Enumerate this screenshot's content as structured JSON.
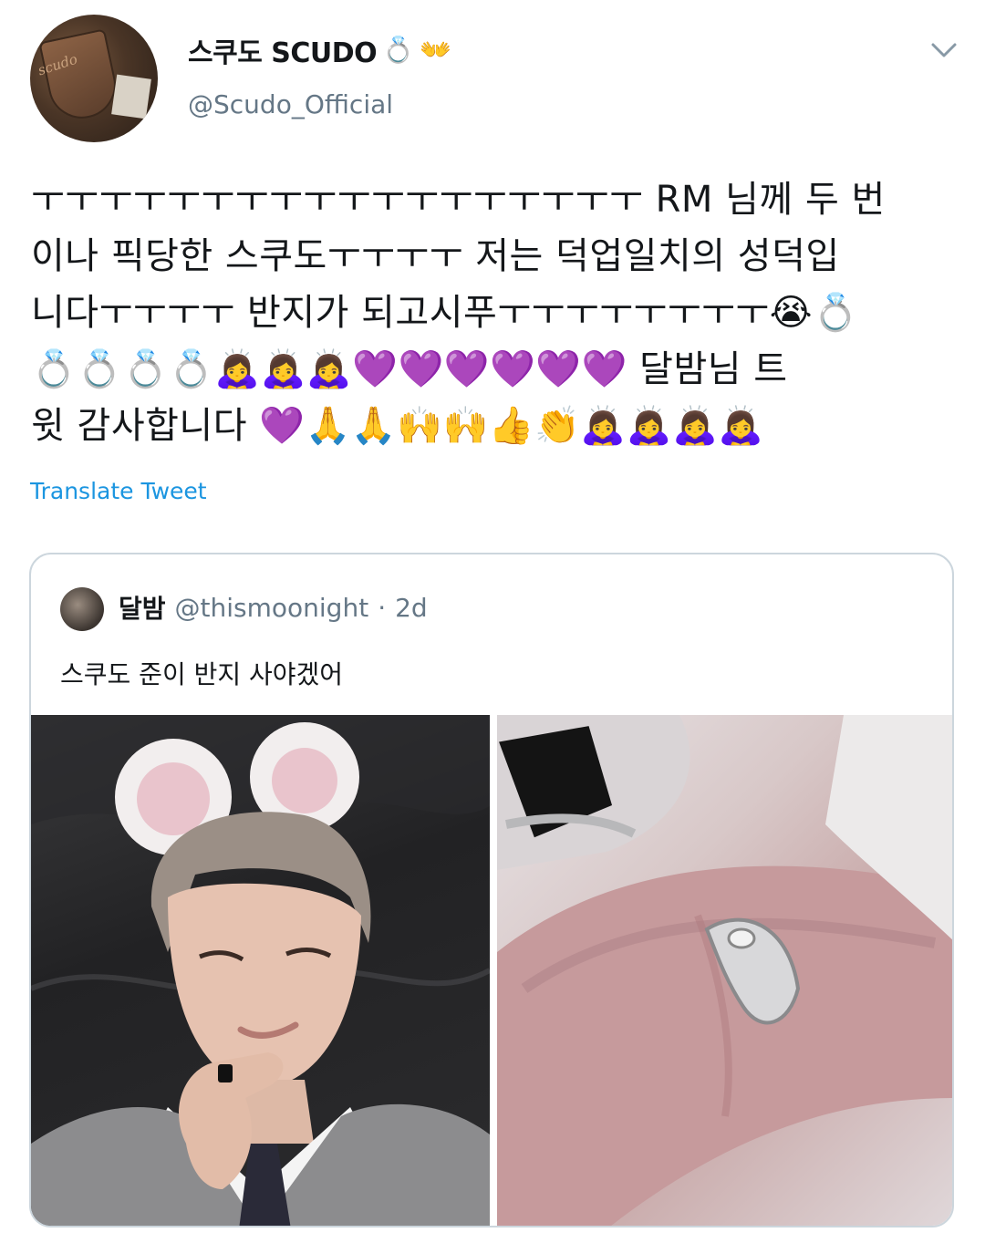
{
  "tweet": {
    "author": {
      "display_name": "스쿠도 SCUDO",
      "name_emojis": [
        "💍",
        "👐"
      ],
      "handle": "@Scudo_Official",
      "avatar_text": "scudo"
    },
    "text_lines": [
      "ㅜㅜㅜㅜㅜㅜㅜㅜㅜㅜㅜㅜㅜㅜㅜㅜㅜㅜ RM 님께 두 번",
      "이나 픽당한 스쿠도ㅜㅜㅜㅜ 저는 덕업일치의 성덕입",
      "니다ㅜㅜㅜㅜ 반지가 되고시푸ㅜㅜㅜㅜㅜㅜㅜㅜ😭💍",
      "💍💍💍💍🙇‍♀️🙇‍♀️🙇‍♀️💜💜💜💜💜💜 달밤님 트",
      "윗 감사합니다 💜🙏🙏🙌🙌👍👏🙇‍♀️🙇‍♀️🙇‍♀️🙇‍♀️"
    ],
    "translate_label": "Translate Tweet",
    "menu_icon": "chevron-down-icon"
  },
  "quoted": {
    "display_name": "달밤",
    "handle": "@thismoonight",
    "separator": "·",
    "time": "2d",
    "text": "스쿠도 준이 반지 사야겠어",
    "media": [
      "person-with-mouse-ears-photo",
      "ring-on-hand-closeup-photo"
    ]
  },
  "colors": {
    "text": "#14171a",
    "secondary": "#657786",
    "link": "#1b95e0",
    "border": "#ccd6dd"
  }
}
